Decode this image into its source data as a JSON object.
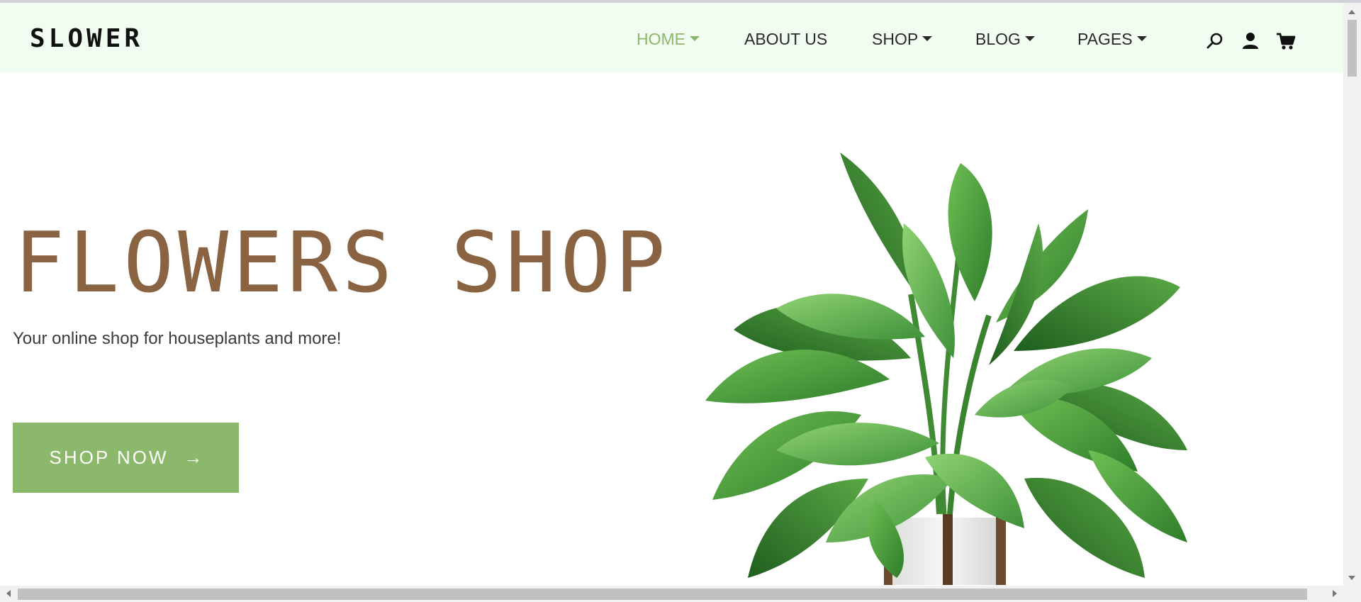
{
  "brand": {
    "logo_text": "SLOWER"
  },
  "nav": {
    "items": [
      {
        "label": "HOME",
        "active": true
      },
      {
        "label": "ABOUT US"
      },
      {
        "label": "SHOP"
      },
      {
        "label": "BLOG"
      },
      {
        "label": "PAGES"
      }
    ],
    "icons": [
      "search-icon",
      "user-icon",
      "cart-icon"
    ]
  },
  "hero": {
    "title": "FLOWERS SHOP",
    "subtitle": "Your online shop for houseplants and more!",
    "cta_label": "SHOP NOW",
    "cta_arrow": "→"
  },
  "colors": {
    "accent": "#8cb86b",
    "title_brown": "#8a6342",
    "nav_bg": "#f1fdf0"
  }
}
